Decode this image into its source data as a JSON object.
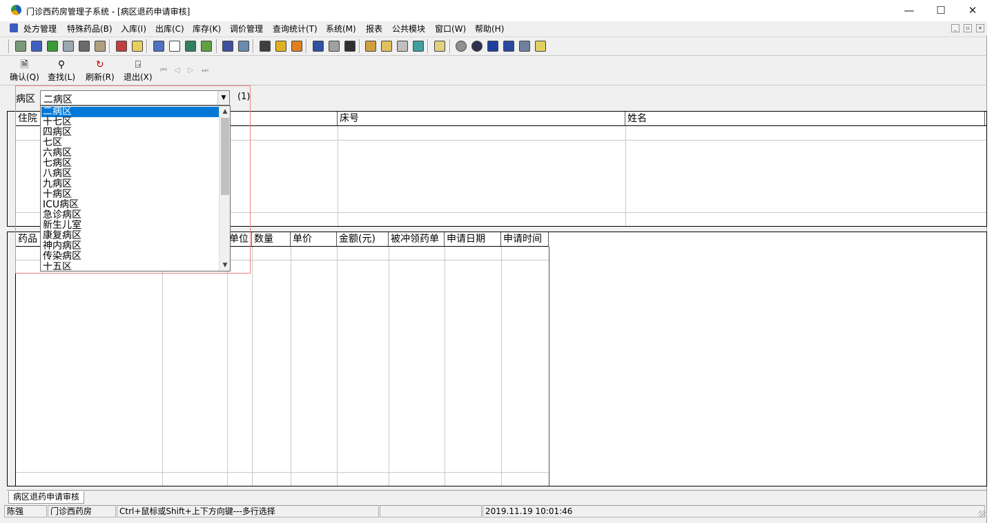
{
  "window": {
    "title": "门诊西药房管理子系统 - [病区退药申请审核]",
    "controls": {
      "minimize": "—",
      "maximize": "☐",
      "close": "✕"
    }
  },
  "menu": [
    "处方管理",
    "特殊药品(B)",
    "入库(I)",
    "出库(C)",
    "库存(K)",
    "调价管理",
    "查询统计(T)",
    "系统(M)",
    "报表",
    "公共模块",
    "窗口(W)",
    "帮助(H)"
  ],
  "actions": [
    {
      "label": "确认(Q)",
      "icon": "document-check-icon"
    },
    {
      "label": "查找(L)",
      "icon": "magnifier-icon"
    },
    {
      "label": "刷新(R)",
      "icon": "refresh-icon"
    },
    {
      "label": "退出(X)",
      "icon": "exit-door-icon"
    }
  ],
  "nav_arrows": [
    "⏮",
    "◁",
    "▷",
    "⏭"
  ],
  "filter": {
    "label": "病区",
    "selected": "二病区",
    "hint": "(1)",
    "options": [
      "二病区",
      "十七区",
      "四病区",
      "七区",
      "六病区",
      "七病区",
      "八病区",
      "九病区",
      "十病区",
      "ICU病区",
      "急诊病区",
      "新生儿室",
      "康复病区",
      "神内病区",
      "传染病区",
      "十五区"
    ]
  },
  "top_grid": {
    "columns": [
      "住院",
      "床号",
      "姓名"
    ]
  },
  "bottom_grid": {
    "columns": [
      "药品",
      "单位",
      "数量",
      "单价",
      "金额(元)",
      "被冲领药单",
      "申请日期",
      "申请时间"
    ]
  },
  "tabs": [
    "病区退药申请审核"
  ],
  "status": {
    "user": "陈强",
    "dept": "门诊西药房",
    "tip": "Ctrl+鼠标或Shift+上下方向键---多行选择",
    "datetime": "2019.11.19 10:01:46"
  }
}
